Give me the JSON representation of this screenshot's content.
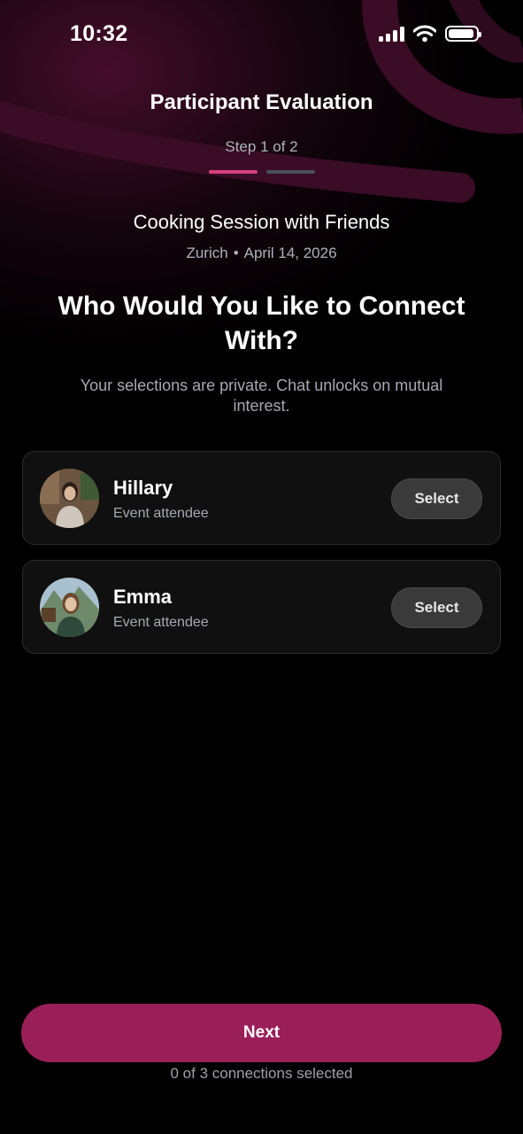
{
  "status_bar": {
    "time": "10:32"
  },
  "header": {
    "title": "Participant Evaluation",
    "step_label": "Step 1 of 2",
    "steps_total": 2,
    "steps_current": 1
  },
  "event": {
    "title": "Cooking Session with Friends",
    "city": "Zurich",
    "separator": "•",
    "date": "April 14, 2026"
  },
  "prompt": {
    "heading": "Who Would You Like to Connect With?",
    "subtext": "Your selections are private. Chat unlocks on mutual interest."
  },
  "participants": [
    {
      "name": "Hillary",
      "role": "Event attendee",
      "button_label": "Select"
    },
    {
      "name": "Emma",
      "role": "Event attendee",
      "button_label": "Select"
    }
  ],
  "footer": {
    "next_label": "Next",
    "selection_count": "0 of 3 connections selected"
  },
  "colors": {
    "accent": "#9a1f58",
    "active_step": "#d6417f",
    "inactive_step": "#4a4f59",
    "background": "#000000"
  }
}
